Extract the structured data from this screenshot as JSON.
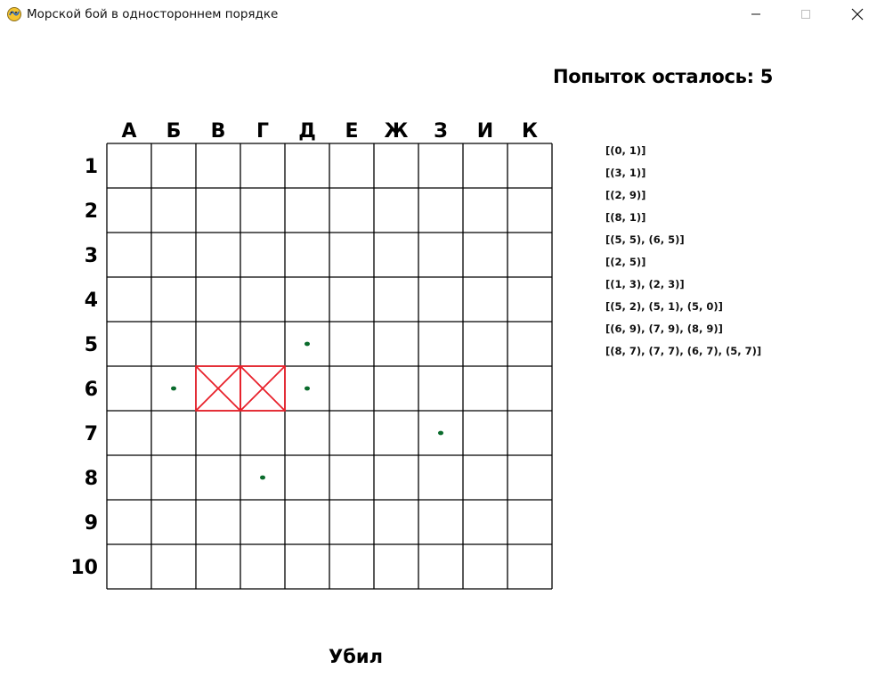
{
  "window": {
    "title": "Морской бой в одностороннем порядке",
    "icon": "pygame-snake-icon",
    "controls": {
      "minimize": "minimize-icon",
      "maximize": "maximize-icon",
      "close": "close-icon"
    }
  },
  "status": {
    "attempts_text": "Попыток осталось: 5",
    "result_text": "Убил"
  },
  "board": {
    "columns": [
      "А",
      "Б",
      "В",
      "Г",
      "Д",
      "Е",
      "Ж",
      "З",
      "И",
      "К"
    ],
    "rows": [
      "1",
      "2",
      "3",
      "4",
      "5",
      "6",
      "7",
      "8",
      "9",
      "10"
    ],
    "grid_color": "#000000",
    "hit_color": "#e8202a",
    "miss_color": "#0a6b2c",
    "hits": [
      {
        "col": "В",
        "row": "6"
      },
      {
        "col": "Г",
        "row": "6"
      }
    ],
    "misses": [
      {
        "col": "Д",
        "row": "5"
      },
      {
        "col": "Б",
        "row": "6"
      },
      {
        "col": "Д",
        "row": "6"
      },
      {
        "col": "З",
        "row": "7"
      },
      {
        "col": "Г",
        "row": "8"
      }
    ]
  },
  "ships": [
    "[(0, 1)]",
    "[(3, 1)]",
    "[(2, 9)]",
    "[(8, 1)]",
    "[(5, 5), (6, 5)]",
    "[(2, 5)]",
    "[(1, 3), (2, 3)]",
    "[(5, 2), (5, 1), (5, 0)]",
    "[(6, 9), (7, 9), (8, 9)]",
    "[(8, 7), (7, 7), (6, 7), (5, 7)]"
  ]
}
